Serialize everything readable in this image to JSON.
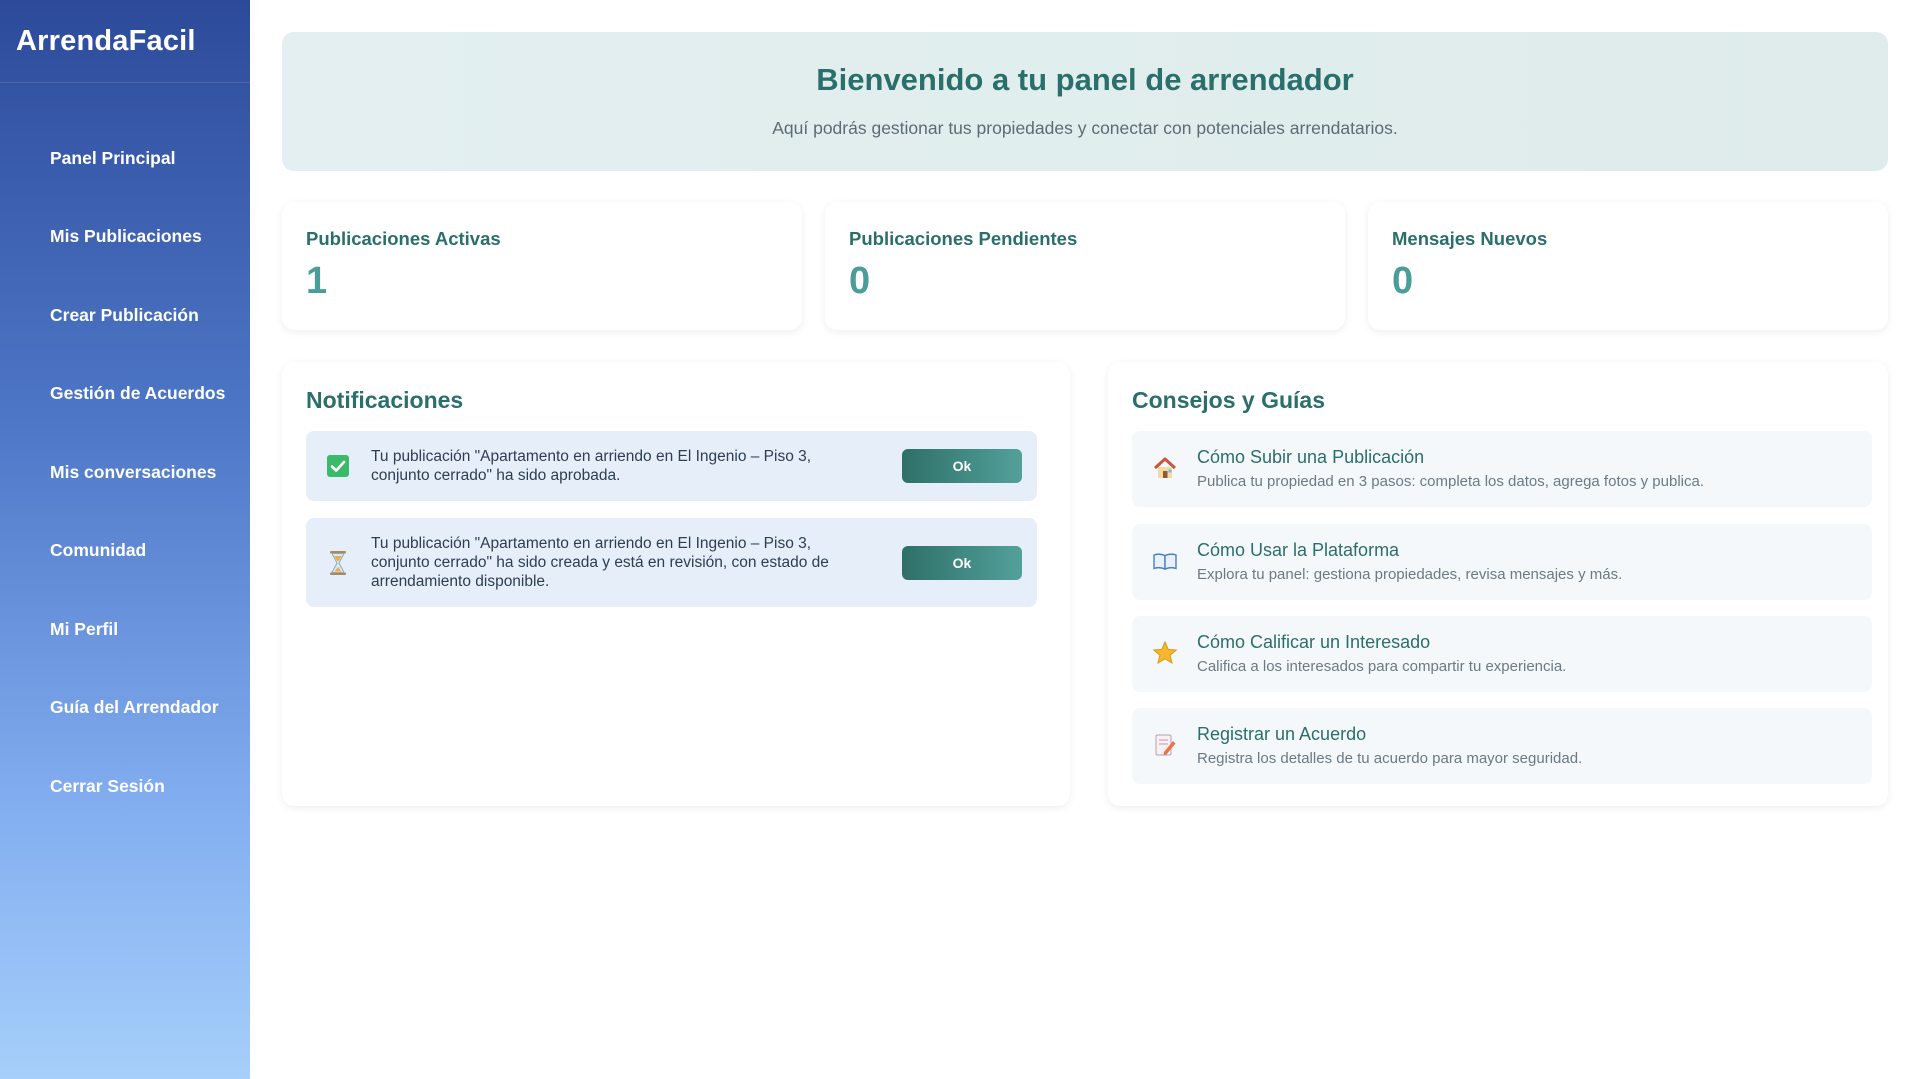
{
  "sidebar": {
    "brand": "ArrendaFacil",
    "items": [
      {
        "label": "Panel Principal"
      },
      {
        "label": "Mis Publicaciones"
      },
      {
        "label": "Crear Publicación"
      },
      {
        "label": "Gestión de Acuerdos"
      },
      {
        "label": "Mis conversaciones"
      },
      {
        "label": "Comunidad"
      },
      {
        "label": "Mi Perfil"
      },
      {
        "label": "Guía del Arrendador"
      },
      {
        "label": "Cerrar Sesión"
      }
    ]
  },
  "welcome": {
    "title": "Bienvenido a tu panel de arrendador",
    "subtitle": "Aquí podrás gestionar tus propiedades y conectar con potenciales arrendatarios."
  },
  "stats": [
    {
      "label": "Publicaciones Activas",
      "value": "1"
    },
    {
      "label": "Publicaciones Pendientes",
      "value": "0"
    },
    {
      "label": "Mensajes Nuevos",
      "value": "0"
    }
  ],
  "notifications": {
    "title": "Notificaciones",
    "items": [
      {
        "icon": "check-icon",
        "text": "Tu publicación \"Apartamento en arriendo en El Ingenio – Piso 3, conjunto cerrado\" ha sido aprobada.",
        "button": "Ok"
      },
      {
        "icon": "hourglass-icon",
        "text": "Tu publicación \"Apartamento en arriendo en El Ingenio – Piso 3, conjunto cerrado\" ha sido creada y está en revisión, con estado de arrendamiento disponible.",
        "button": "Ok"
      }
    ]
  },
  "tips": {
    "title": "Consejos y Guías",
    "items": [
      {
        "icon": "house-icon",
        "title": "Cómo Subir una Publicación",
        "desc": "Publica tu propiedad en 3 pasos: completa los datos, agrega fotos y publica."
      },
      {
        "icon": "book-icon",
        "title": "Cómo Usar la Plataforma",
        "desc": "Explora tu panel: gestiona propiedades, revisa mensajes y más."
      },
      {
        "icon": "star-icon",
        "title": "Cómo Calificar un Interesado",
        "desc": "Califica a los interesados para compartir tu experiencia."
      },
      {
        "icon": "memo-icon",
        "title": "Registrar un Acuerdo",
        "desc": "Registra los detalles de tu acuerdo para mayor seguridad."
      }
    ]
  },
  "colors": {
    "accent": "#2a6f6b",
    "stat_value": "#4a9e99",
    "notification_bg": "#e6eff9"
  }
}
